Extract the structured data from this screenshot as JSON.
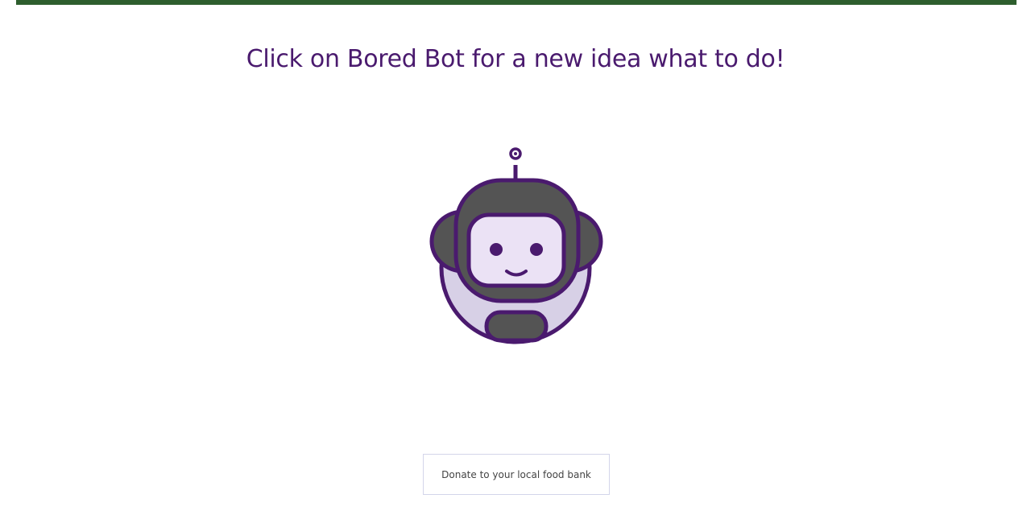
{
  "colors": {
    "top_bar": "#2e5e2e",
    "title_text": "#4a1a6e",
    "bot_outline": "#4a1a6e",
    "bot_body": "#545454",
    "bot_face": "#ebe2f5",
    "bot_lower": "#d7d0e6",
    "activity_border": "#d3d5ea"
  },
  "header": {
    "title": "Click on Bored Bot for a new idea what to do!"
  },
  "bot": {
    "icon": "robot-icon"
  },
  "activity": {
    "text": "Donate to your local food bank"
  }
}
